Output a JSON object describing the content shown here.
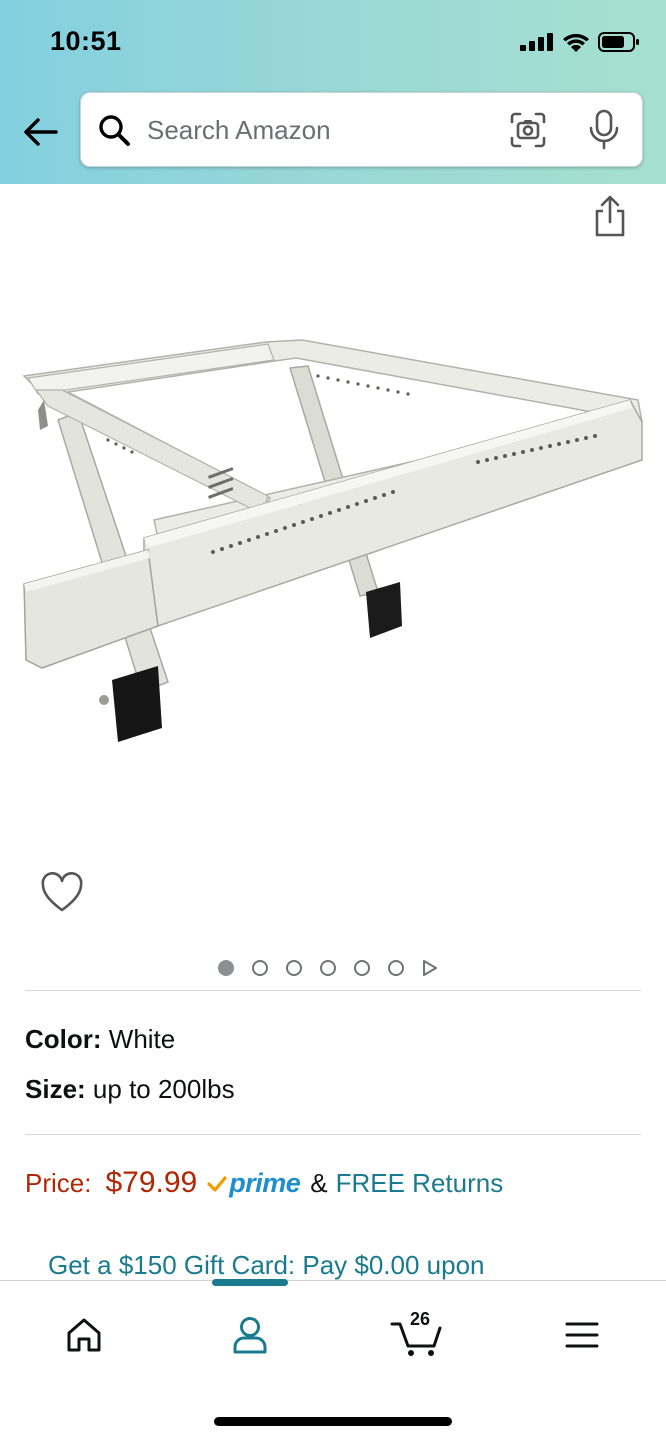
{
  "status_bar": {
    "time": "10:51",
    "icons": [
      "signal-icon",
      "wifi-icon",
      "battery-icon"
    ]
  },
  "header": {
    "back_icon": "arrow-left-icon",
    "search": {
      "placeholder": "Search Amazon",
      "value": "",
      "icons": [
        "search-icon",
        "camera-icon",
        "microphone-icon"
      ]
    }
  },
  "product": {
    "share_icon": "share-icon",
    "wishlist_icon": "heart-icon",
    "image_dots": {
      "count": 6,
      "active_index": 0,
      "has_video": true
    },
    "color": {
      "label": "Color:",
      "value": "White"
    },
    "size": {
      "label": "Size:",
      "value": "up to 200lbs"
    },
    "price": {
      "label": "Price:",
      "value": "$79.99",
      "prime": "prime",
      "amp": "&",
      "returns": "FREE Returns"
    },
    "gift_card": "Get a $150 Gift Card: Pay $0.00 upon"
  },
  "tabbar": {
    "active_index": 1,
    "tabs": [
      {
        "name": "home",
        "icon": "home-icon"
      },
      {
        "name": "account",
        "icon": "person-icon"
      },
      {
        "name": "cart",
        "icon": "cart-icon",
        "count": "26"
      },
      {
        "name": "menu",
        "icon": "menu-icon"
      }
    ]
  },
  "colors": {
    "price": "#b12704",
    "link": "#1a7a8e",
    "prime": "#1f8ecf",
    "prime_check": "#f29a00",
    "header_gradient_start": "#83d0e0",
    "header_gradient_end": "#a6e0cf"
  }
}
